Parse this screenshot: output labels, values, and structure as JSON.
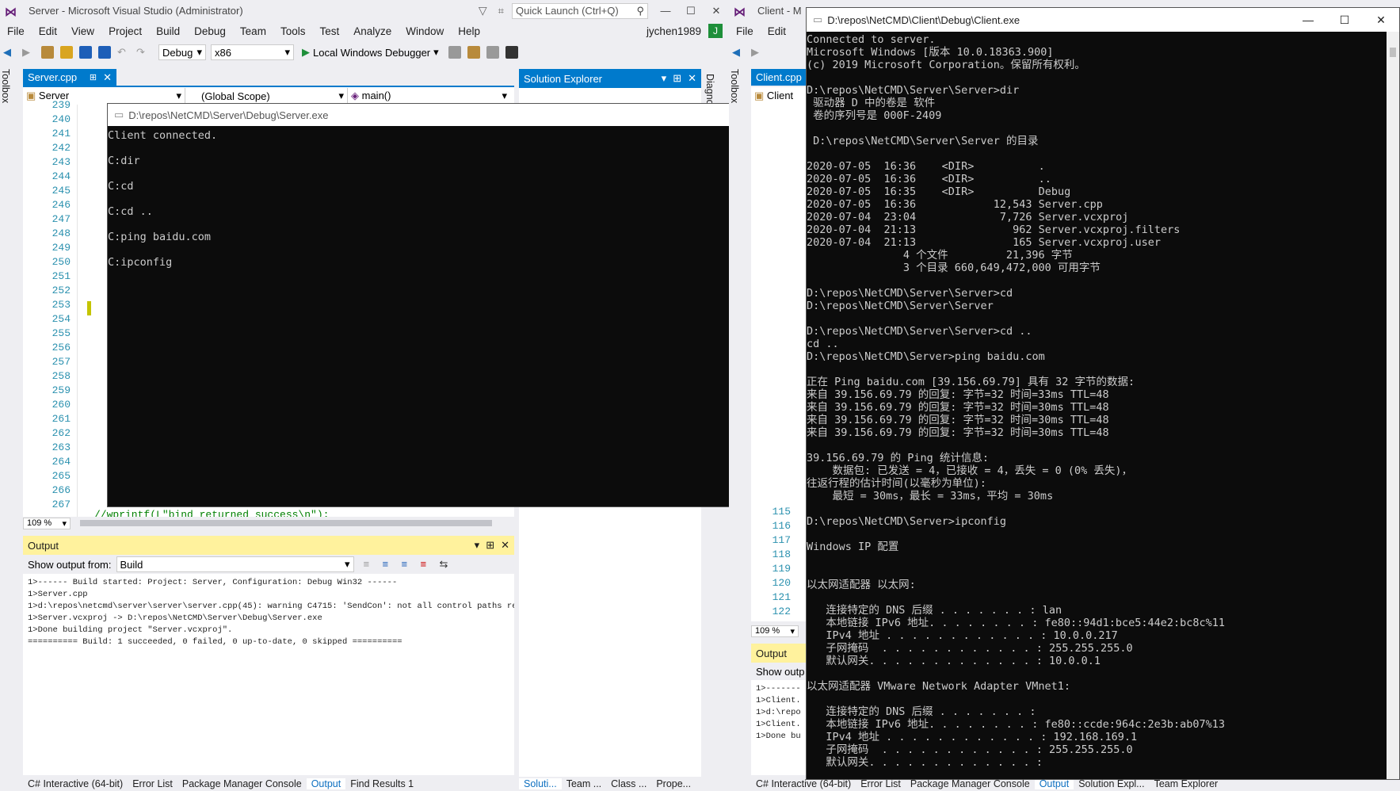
{
  "vs_server": {
    "title": "Server - Microsoft Visual Studio  (Administrator)",
    "quick_launch_placeholder": "Quick Launch (Ctrl+Q)",
    "menu": [
      "File",
      "Edit",
      "View",
      "Project",
      "Build",
      "Debug",
      "Team",
      "Tools",
      "Test",
      "Analyze",
      "Window",
      "Help"
    ],
    "user": "jychen1989",
    "avatar_letter": "J",
    "config": "Debug",
    "platform": "x86",
    "debugger": "Local Windows Debugger",
    "toolbox_label": "Toolbox",
    "doc_tab": "Server.cpp",
    "nav_project": "Server",
    "nav_scope": "(Global Scope)",
    "nav_member": "main()",
    "line_numbers": [
      "239",
      "240",
      "241",
      "242",
      "243",
      "244",
      "245",
      "246",
      "247",
      "248",
      "249",
      "250",
      "251",
      "252",
      "253",
      "254",
      "255",
      "256",
      "257",
      "258",
      "259",
      "260",
      "261",
      "262",
      "263",
      "264",
      "265",
      "266",
      "267"
    ],
    "code_last_line": "//wprintf(L\"bind returned success\\n\");",
    "zoom": "109 %",
    "solution_explorer_title": "Solution Explorer",
    "diag_label": "Diagno",
    "output_title": "Output",
    "show_output_label": "Show output from:",
    "show_output_value": "Build",
    "output_lines": [
      "1>------ Build started: Project: Server, Configuration: Debug Win32 ------",
      "1>Server.cpp",
      "1>d:\\repos\\netcmd\\server\\server\\server.cpp(45): warning C4715: 'SendCon': not all control paths re",
      "1>Server.vcxproj -> D:\\repos\\NetCMD\\Server\\Debug\\Server.exe",
      "1>Done building project \"Server.vcxproj\".",
      "========== Build: 1 succeeded, 0 failed, 0 up-to-date, 0 skipped =========="
    ],
    "bottom_tabs": [
      "C# Interactive (64-bit)",
      "Error List",
      "Package Manager Console",
      "Output",
      "Find Results 1"
    ],
    "se_bottom_tabs": [
      "Soluti...",
      "Team ...",
      "Class ...",
      "Prope..."
    ]
  },
  "server_console": {
    "title": "D:\\repos\\NetCMD\\Server\\Debug\\Server.exe",
    "lines": [
      "Client connected.",
      "",
      "C:dir",
      "",
      "C:cd",
      "",
      "C:cd ..",
      "",
      "C:ping baidu.com",
      "",
      "C:ipconfig"
    ]
  },
  "vs_client": {
    "title": "Client - M",
    "menu": [
      "File",
      "Edit"
    ],
    "toolbox_label": "Toolbox",
    "doc_tab": "Client.cpp",
    "nav_project": "Client",
    "line_numbers": [
      "115",
      "116",
      "117",
      "118",
      "119",
      "120",
      "121",
      "122"
    ],
    "zoom": "109 %",
    "output_title": "Output",
    "show_output_label": "Show outp",
    "output_lines": [
      "1>-------",
      "1>Client.",
      "1>d:\\repo",
      "1>Client.",
      "1>Done bu"
    ],
    "bottom_tabs": [
      "C# Interactive (64-bit)",
      "Error List",
      "Package Manager Console",
      "Output",
      "Solution Expl...",
      "Team Explorer"
    ]
  },
  "client_console": {
    "title": "D:\\repos\\NetCMD\\Client\\Debug\\Client.exe",
    "lines": [
      "Connected to server.",
      "Microsoft Windows [版本 10.0.18363.900]",
      "(c) 2019 Microsoft Corporation。保留所有权利。",
      "",
      "D:\\repos\\NetCMD\\Server\\Server>dir",
      " 驱动器 D 中的卷是 软件",
      " 卷的序列号是 000F-2409",
      "",
      " D:\\repos\\NetCMD\\Server\\Server 的目录",
      "",
      "2020-07-05  16:36    <DIR>          .",
      "2020-07-05  16:36    <DIR>          ..",
      "2020-07-05  16:35    <DIR>          Debug",
      "2020-07-05  16:36            12,543 Server.cpp",
      "2020-07-04  23:04             7,726 Server.vcxproj",
      "2020-07-04  21:13               962 Server.vcxproj.filters",
      "2020-07-04  21:13               165 Server.vcxproj.user",
      "               4 个文件         21,396 字节",
      "               3 个目录 660,649,472,000 可用字节",
      "",
      "D:\\repos\\NetCMD\\Server\\Server>cd",
      "D:\\repos\\NetCMD\\Server\\Server",
      "",
      "D:\\repos\\NetCMD\\Server\\Server>cd ..",
      "cd ..",
      "D:\\repos\\NetCMD\\Server>ping baidu.com",
      "",
      "正在 Ping baidu.com [39.156.69.79] 具有 32 字节的数据:",
      "来自 39.156.69.79 的回复: 字节=32 时间=33ms TTL=48",
      "来自 39.156.69.79 的回复: 字节=32 时间=30ms TTL=48",
      "来自 39.156.69.79 的回复: 字节=32 时间=30ms TTL=48",
      "来自 39.156.69.79 的回复: 字节=32 时间=30ms TTL=48",
      "",
      "39.156.69.79 的 Ping 统计信息:",
      "    数据包: 已发送 = 4，已接收 = 4，丢失 = 0 (0% 丢失)，",
      "往返行程的估计时间(以毫秒为单位):",
      "    最短 = 30ms，最长 = 33ms，平均 = 30ms",
      "",
      "D:\\repos\\NetCMD\\Server>ipconfig",
      "",
      "Windows IP 配置",
      "",
      "",
      "以太网适配器 以太网:",
      "",
      "   连接特定的 DNS 后缀 . . . . . . . : lan",
      "   本地链接 IPv6 地址. . . . . . . . : fe80::94d1:bce5:44e2:bc8c%11",
      "   IPv4 地址 . . . . . . . . . . . . : 10.0.0.217",
      "   子网掩码  . . . . . . . . . . . . : 255.255.255.0",
      "   默认网关. . . . . . . . . . . . . : 10.0.0.1",
      "",
      "以太网适配器 VMware Network Adapter VMnet1:",
      "",
      "   连接特定的 DNS 后缀 . . . . . . . :",
      "   本地链接 IPv6 地址. . . . . . . . : fe80::ccde:964c:2e3b:ab07%13",
      "   IPv4 地址 . . . . . . . . . . . . : 192.168.169.1",
      "   子网掩码  . . . . . . . . . . . . : 255.255.255.0",
      "   默认网关. . . . . . . . . . . . . :"
    ]
  }
}
